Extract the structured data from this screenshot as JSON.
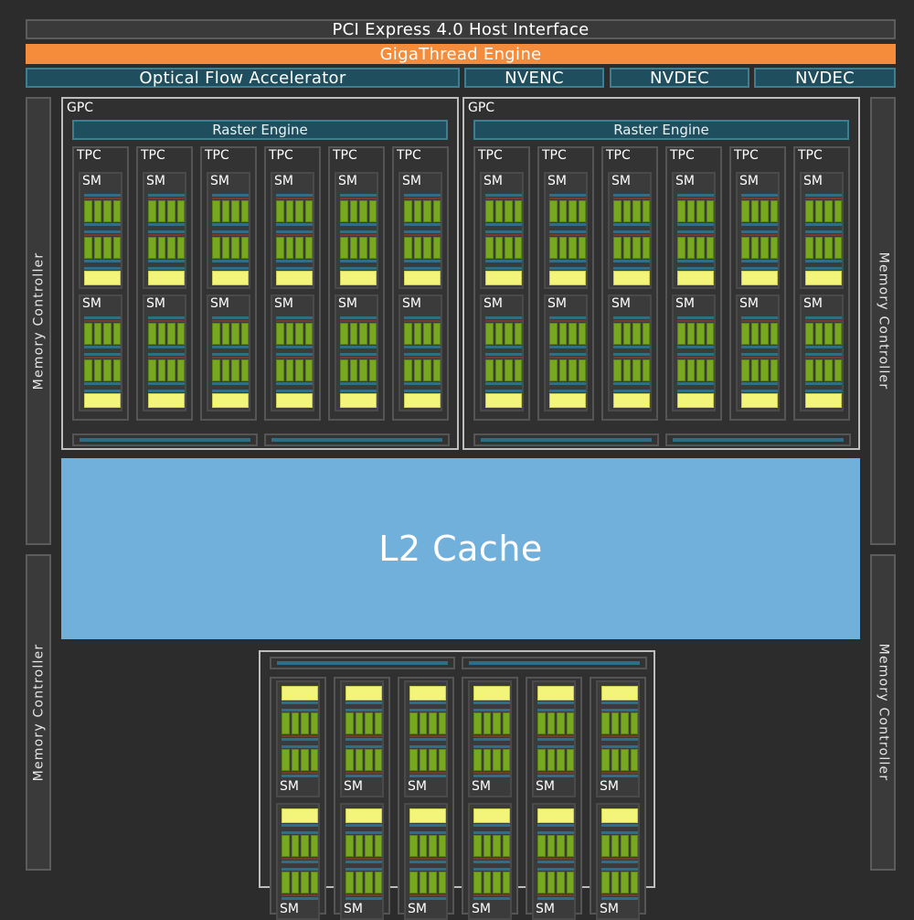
{
  "header": {
    "pcie_label": "PCI Express 4.0 Host Interface",
    "gigathread_label": "GigaThread Engine"
  },
  "engines": {
    "optical_flow_label": "Optical Flow Accelerator",
    "nvenc_label": "NVENC",
    "nvdec_1_label": "NVDEC",
    "nvdec_2_label": "NVDEC"
  },
  "memory_controller_label": "Memory Controller",
  "gpc": {
    "label": "GPC",
    "raster_label": "Raster Engine",
    "tpc_label": "TPC",
    "sm_label": "SM"
  },
  "l2_label": "L2 Cache",
  "colors": {
    "background": "#2c2c2c",
    "gigathread": "#f58c3b",
    "engine_teal": "#1f4f5e",
    "l2_cache": "#72b0dc",
    "sm_cores": "#78a81f",
    "sm_cache": "#f2f57a"
  }
}
